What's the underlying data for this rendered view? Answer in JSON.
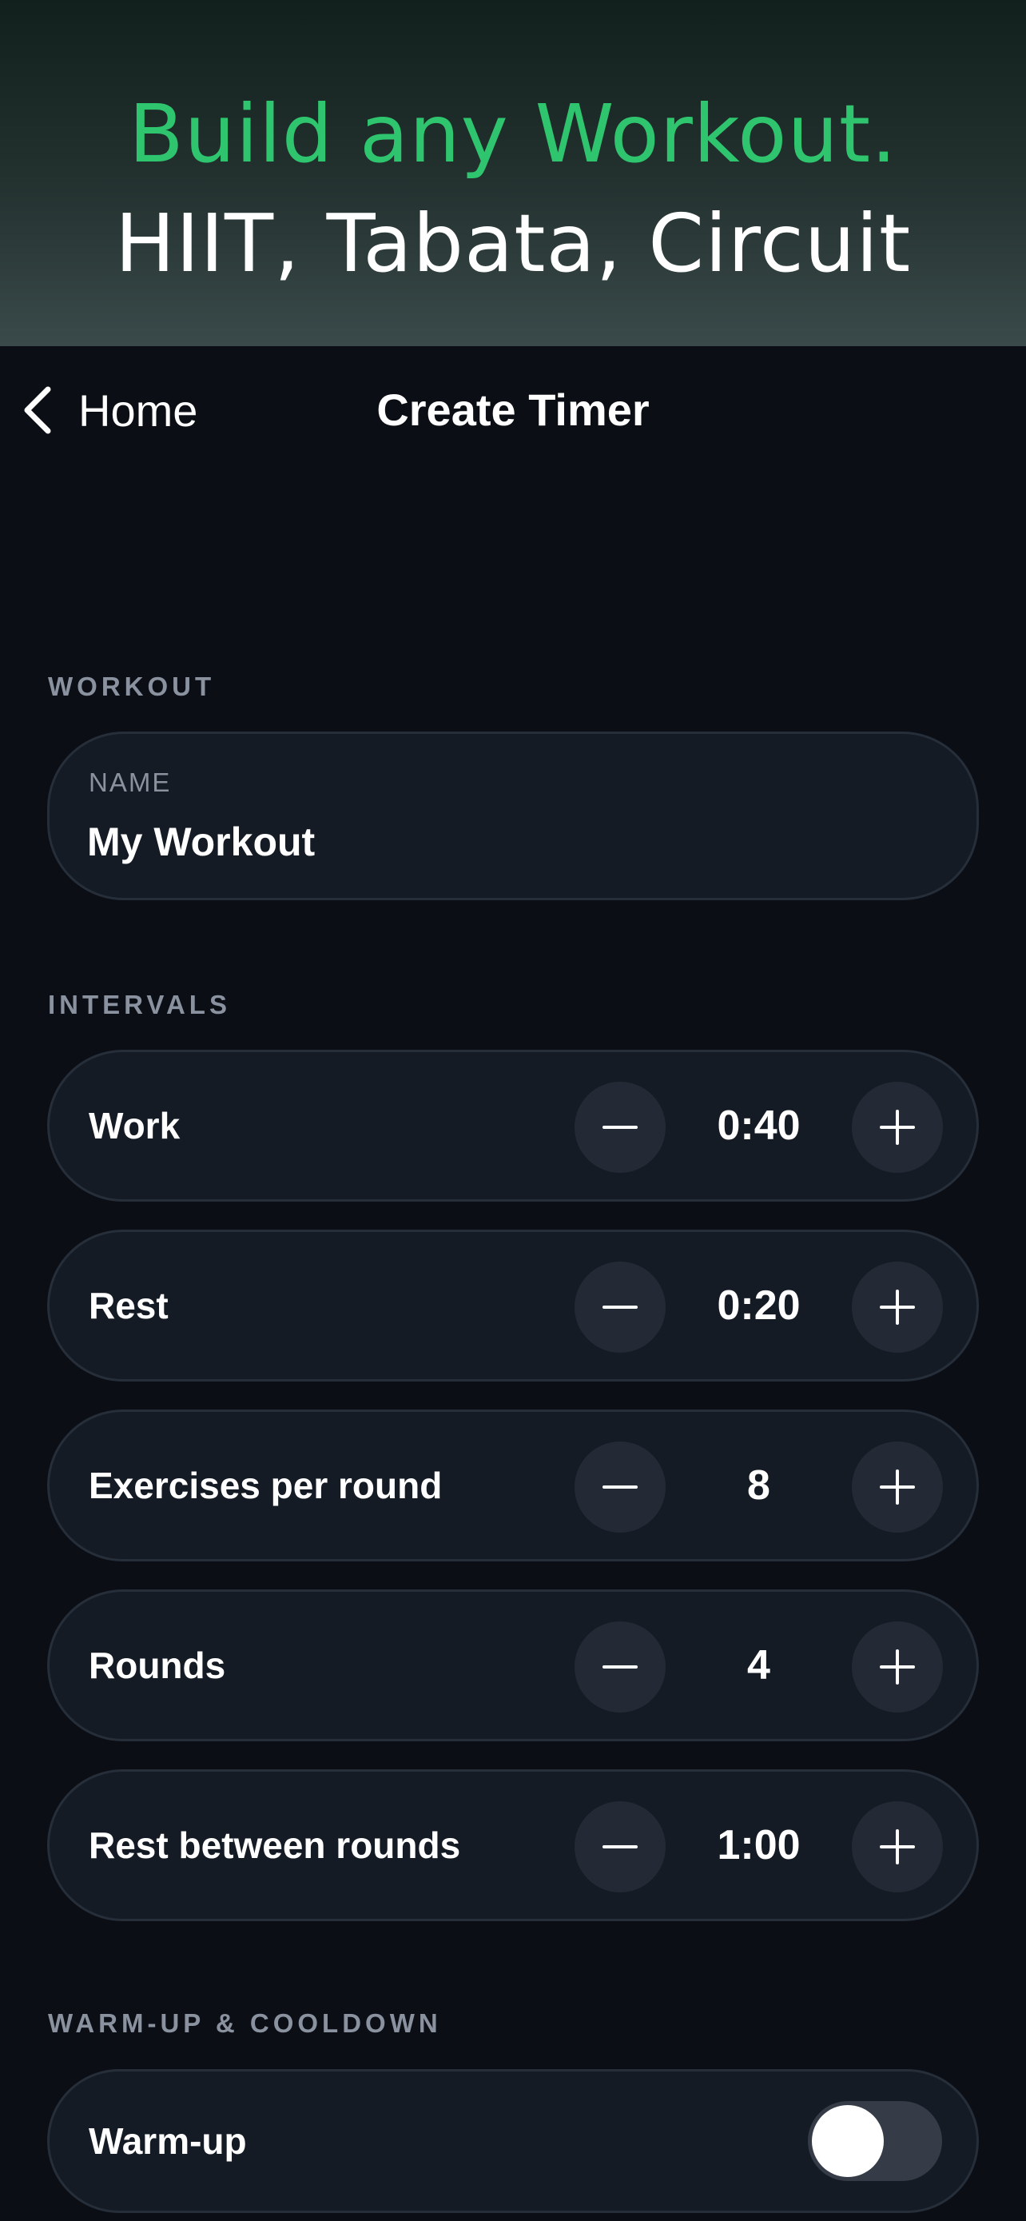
{
  "promo": {
    "headline": "Build any Workout.",
    "subline": "HIIT, Tabata, Circuit"
  },
  "nav": {
    "back_label": "Home",
    "title": "Create Timer"
  },
  "sections": {
    "workout": "WORKOUT",
    "intervals": "INTERVALS",
    "warmup_cooldown": "WARM-UP & COOLDOWN"
  },
  "workout": {
    "name_label": "NAME",
    "name_value": "My Workout"
  },
  "intervals": [
    {
      "label": "Work",
      "value": "0:40"
    },
    {
      "label": "Rest",
      "value": "0:20"
    },
    {
      "label": "Exercises per round",
      "value": "8"
    },
    {
      "label": "Rounds",
      "value": "4"
    },
    {
      "label": "Rest between rounds",
      "value": "1:00"
    }
  ],
  "warmup": {
    "label": "Warm-up",
    "enabled": false
  },
  "colors": {
    "accent_green": "#2fc46e",
    "background": "#0b0e14",
    "card": "#151b24"
  }
}
